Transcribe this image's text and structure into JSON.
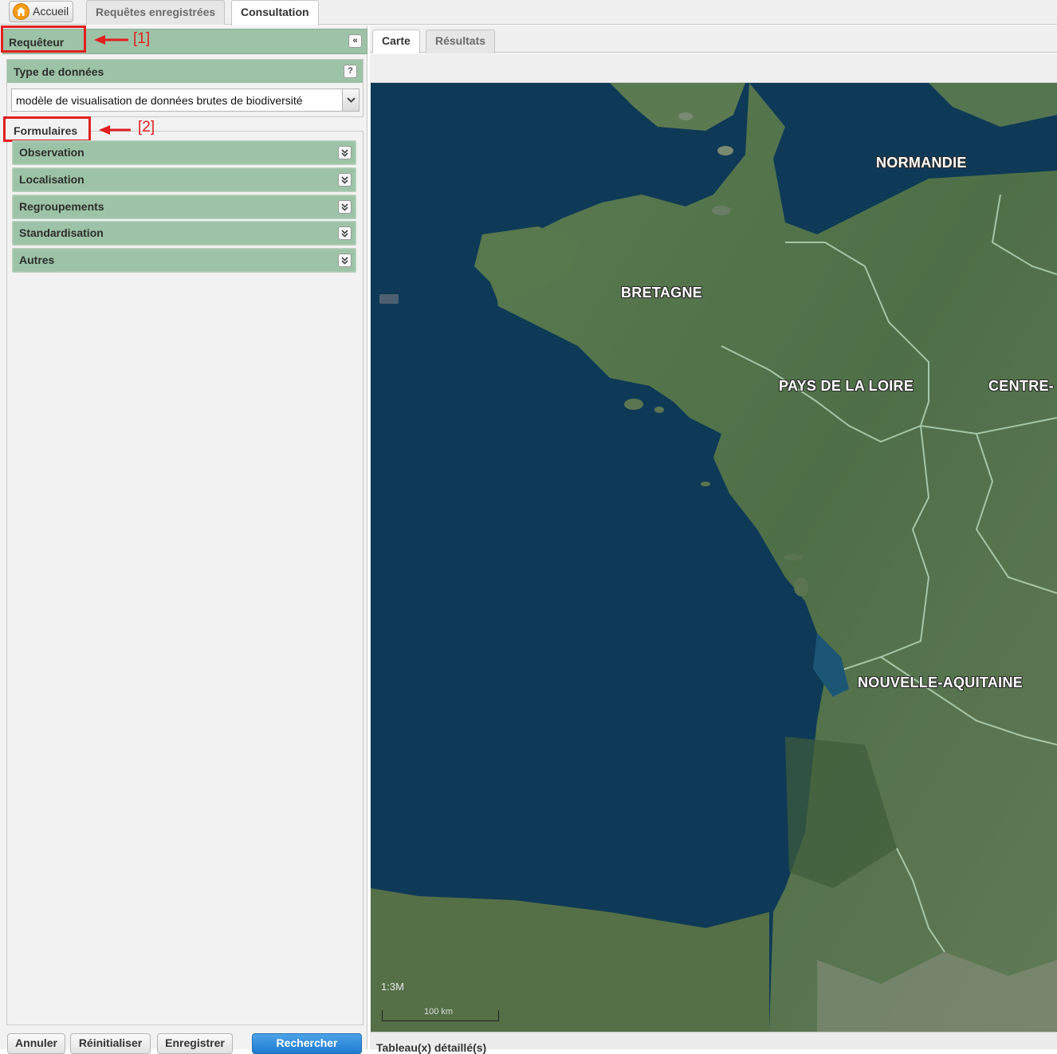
{
  "top_tabs": {
    "home_label": "Accueil",
    "saved_requests_label": "Requêtes enregistrées",
    "consultation_label": "Consultation"
  },
  "left_panel": {
    "title": "Requêteur",
    "collapse_glyph": "«",
    "annotations": [
      "[1]",
      "[2]"
    ],
    "data_type": {
      "title": "Type de données",
      "help_glyph": "?",
      "selected_value": "modèle de visualisation de données brutes de biodiversité"
    },
    "forms": {
      "legend": "Formulaires",
      "items": [
        {
          "label": "Observation"
        },
        {
          "label": "Localisation"
        },
        {
          "label": "Regroupements"
        },
        {
          "label": "Standardisation"
        },
        {
          "label": "Autres"
        }
      ]
    },
    "buttons": {
      "cancel": "Annuler",
      "reset": "Réinitialiser",
      "save": "Enregistrer",
      "search": "Rechercher"
    }
  },
  "right_panel": {
    "tabs": {
      "map": "Carte",
      "results": "Résultats"
    },
    "map": {
      "regions": [
        "NORMANDIE",
        "BRETAGNE",
        "PAYS DE LA LOIRE",
        "CENTRE-",
        "NOUVELLE-AQUITAINE"
      ],
      "scale_ratio": "1:3M",
      "scale_bar_label": "100 km"
    },
    "details_title": "Tableau(x) détaillé(s)"
  },
  "colors": {
    "panel_header_green": "#9dc3a6",
    "annotation_red": "#e21f1f",
    "search_button_blue": "#1e7bd1",
    "sea_blue": "#0f3a57",
    "land_green": "#4f6f48"
  }
}
